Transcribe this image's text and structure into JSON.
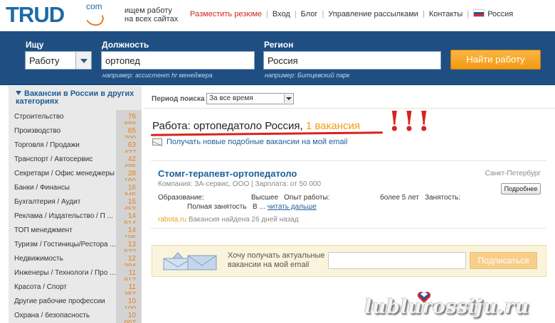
{
  "header": {
    "logo": "TRUD",
    "logo_suffix": "com",
    "tagline_line1": "ищем работу",
    "tagline_line2": "на всех сайтах",
    "nav": [
      {
        "label": "Разместить резюме",
        "accent": true
      },
      {
        "label": "Вход",
        "accent": false
      },
      {
        "label": "Блог",
        "accent": false
      },
      {
        "label": "Управление рассылками",
        "accent": false
      },
      {
        "label": "Контакты",
        "accent": false
      },
      {
        "label": "Россия",
        "accent": false
      }
    ]
  },
  "search": {
    "what_label": "Ищу",
    "what_value": "Работу",
    "position_label": "Должность",
    "position_value": "ортопед",
    "position_hint": "например: ассистент hr менеджера",
    "region_label": "Регион",
    "region_value": "Россия",
    "region_hint": "например: Битцевский парк",
    "button": "Найти работу"
  },
  "sidebar": {
    "title": "Вакансии в России в других категориях",
    "categories": [
      {
        "name": "Строительство",
        "count": "76 859"
      },
      {
        "name": "Производство",
        "count": "65 700"
      },
      {
        "name": "Торговля / Продажи",
        "count": "63 427"
      },
      {
        "name": "Транспорт / Автосервис",
        "count": "42 485"
      },
      {
        "name": "Секретари / Офис менеджеры",
        "count": "28 190"
      },
      {
        "name": "Банки / Финансы",
        "count": "16 345"
      },
      {
        "name": "Бухгалтерия / Аудит",
        "count": "15 453"
      },
      {
        "name": "Реклама / Издательство / П ...",
        "count": "14 514"
      },
      {
        "name": "ТОП менеджмент",
        "count": "14 196"
      },
      {
        "name": "Туризм / Гостиницы/Рестора ...",
        "count": "13 527"
      },
      {
        "name": "Недвижимость",
        "count": "12 394"
      },
      {
        "name": "Инженеры / Технологи / Про ...",
        "count": "11 817"
      },
      {
        "name": "Красота / Спорт",
        "count": "11 357"
      },
      {
        "name": "Другие рабочие профессии",
        "count": "10 100"
      },
      {
        "name": "Охрана / безопасность",
        "count": "10 007"
      }
    ]
  },
  "filter": {
    "period_label": "Период поиска",
    "period_value": "За все время"
  },
  "results": {
    "prefix": "Работа: ",
    "query": "ортопедатоло Россия, ",
    "count": "1 вакансия",
    "annotation": "!!!",
    "subscribe_link": "Получать новые подобные вакансии на мой email"
  },
  "vacancy": {
    "title": "Стомг-терапевт-ортопедатоло",
    "city": "Санкт-Петербург",
    "company": "Компания: ЗА-сервис, ООО | Зарплата: от 50 000",
    "education_label": "Образование:",
    "education_value": "Высшее",
    "experience_label": "Опыт работы:",
    "experience_value": "более 5 лет",
    "employment_label": "Занятость:",
    "employment_value": "Полная занятость",
    "snippet": "В ...",
    "read_more": "читать дальше",
    "more_button": "Подробнее",
    "source": "rabota.ru",
    "found": "Вакансия найдена 26 дней назад"
  },
  "subscribe_box": {
    "text_line1": "Хочу получать актуальные",
    "text_line2": "вакансии на мой email",
    "email_value": "",
    "button": "Подписаться"
  },
  "watermark": "lublurossiju.ru"
}
